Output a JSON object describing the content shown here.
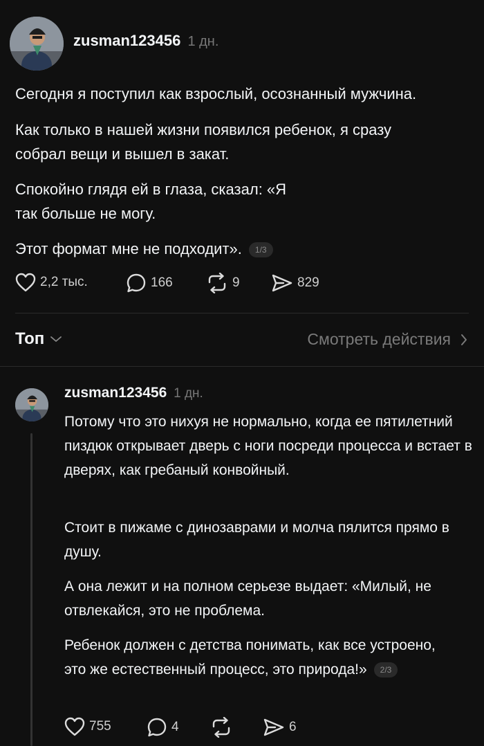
{
  "post": {
    "username": "zusman123456",
    "time": "1 дн.",
    "paragraphs": [
      "Сегодня я поступил как взрослый, осознанный мужчина.",
      "Как только в нашей жизни появился ребенок, я сразу собрал вещи и вышел в закат.",
      "Спокойно глядя ей в глаза, сказал: «Я так больше не могу.",
      "Этот формат мне не подходит»."
    ],
    "pager": "1/3",
    "likes": "2,2 тыс.",
    "comments": "166",
    "reposts": "9",
    "shares": "829"
  },
  "sortbar": {
    "sort_label": "Топ",
    "activity_label": "Смотреть действия"
  },
  "reply": {
    "username": "zusman123456",
    "time": "1 дн.",
    "paragraphs": [
      "Потому что это нихуя не нормально, когда ее пятилетний пиздюк открывает дверь с ноги посреди процесса и встает в дверях, как гребаный конвойный.",
      "Стоит в пижаме с динозаврами и молча пялится прямо в душу.",
      "А она лежит и на полном серьезе выдает: «Милый, не отвлекайся, это не проблема.",
      "Ребенок должен с детства понимать, как все устроено, это же естественный процесс, это природа!»"
    ],
    "pager": "2/3",
    "likes": "755",
    "comments": "4",
    "shares": "6"
  },
  "icons": {
    "like": "heart-icon",
    "comment": "speech-bubble-icon",
    "repost": "repost-arrows-icon",
    "share": "paper-plane-icon",
    "chevron_down": "chevron-down-icon",
    "chevron_right": "chevron-right-icon"
  }
}
